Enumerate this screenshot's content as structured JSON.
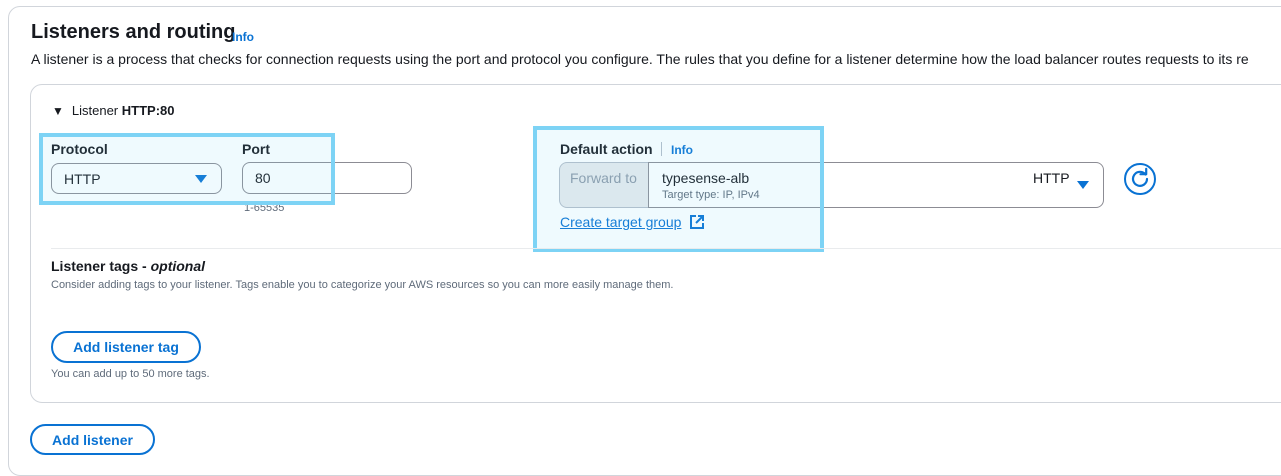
{
  "section": {
    "title": "Listeners and routing",
    "info": "Info",
    "description": "A listener is a process that checks for connection requests using the port and protocol you configure. The rules that you define for a listener determine how the load balancer routes requests to its re"
  },
  "listener": {
    "prefix": "Listener",
    "name": "HTTP:80",
    "protocol": {
      "label": "Protocol",
      "value": "HTTP"
    },
    "port": {
      "label": "Port",
      "value": "80",
      "hint": "1-65535"
    },
    "default_action": {
      "label": "Default action",
      "info": "Info",
      "forward_label": "Forward to",
      "target_group_name": "typesense-alb",
      "target_group_details": "Target type: IP, IPv4",
      "target_group_protocol": "HTTP",
      "create_link": "Create target group"
    },
    "tags": {
      "title": "Listener tags -",
      "title_optional": "optional",
      "description": "Consider adding tags to your listener. Tags enable you to categorize your AWS resources so you can more easily manage them.",
      "add_button": "Add listener tag",
      "limit_note": "You can add up to 50 more tags."
    }
  },
  "add_listener_button": "Add listener",
  "colors": {
    "accent": "#0972d3",
    "highlight": "#7dd3f5",
    "border": "#8c8c94",
    "muted_text": "#5f6b7a"
  },
  "icons": [
    "caret-down-icon",
    "dropdown-arrow-icon",
    "refresh-icon",
    "external-link-icon"
  ]
}
